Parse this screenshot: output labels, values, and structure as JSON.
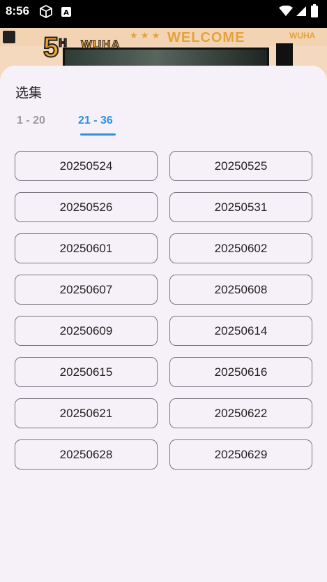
{
  "status_bar": {
    "time": "8:56",
    "icons": [
      "cube-icon",
      "a-square-icon",
      "wifi-icon",
      "signal-icon",
      "battery-icon"
    ]
  },
  "banner": {
    "number": "5",
    "number_sup": "H",
    "brand": "WUHA",
    "welcome": "WELCOME",
    "stars": "★ ★ ★",
    "brand_small": "WUHA"
  },
  "sheet": {
    "title": "选集",
    "tabs": [
      {
        "label": "1 - 20",
        "selected": false
      },
      {
        "label": "21 - 36",
        "selected": true
      }
    ],
    "accent_color": "#2b93e0",
    "episodes": [
      "20250524",
      "20250525",
      "20250526",
      "20250531",
      "20250601",
      "20250602",
      "20250607",
      "20250608",
      "20250609",
      "20250614",
      "20250615",
      "20250616",
      "20250621",
      "20250622",
      "20250628",
      "20250629"
    ]
  }
}
